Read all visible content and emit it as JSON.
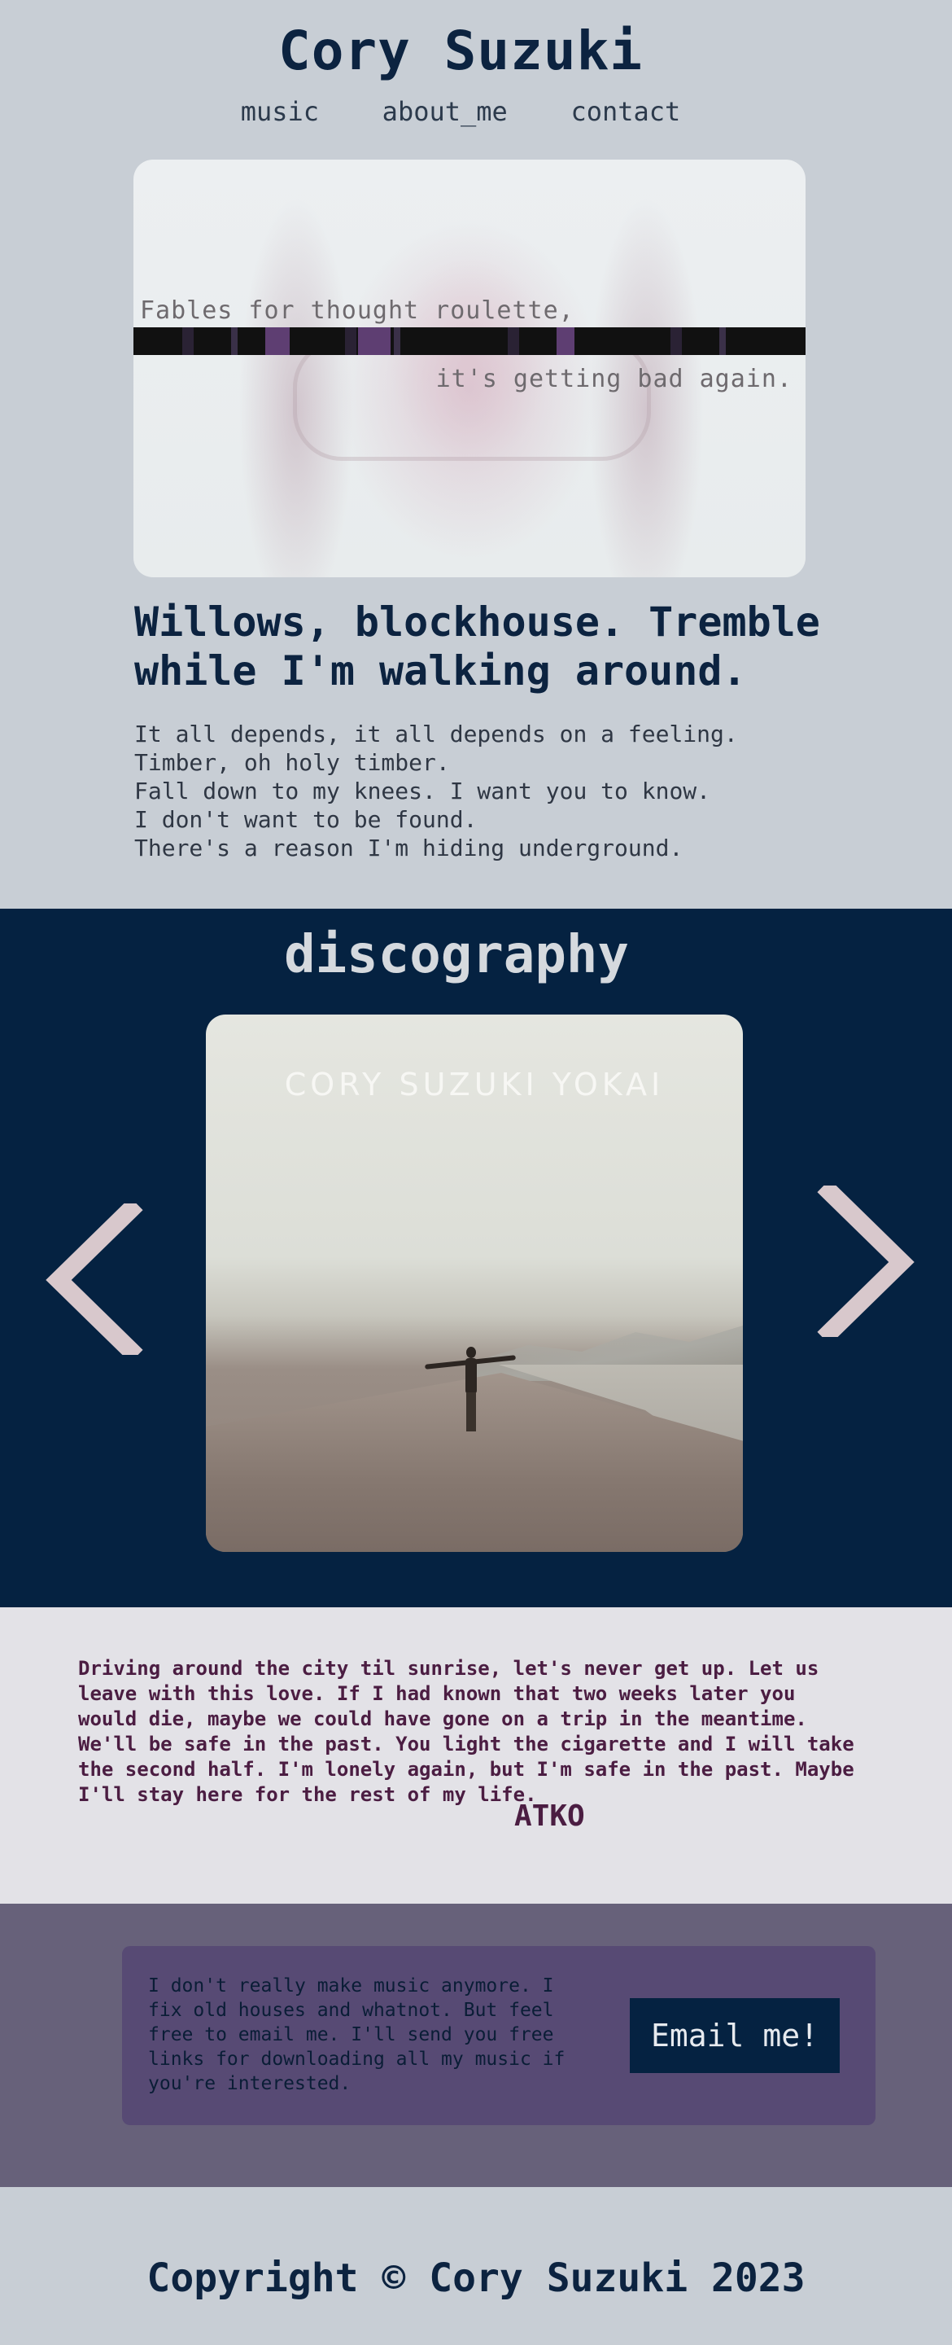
{
  "site": {
    "title": "Cory Suzuki"
  },
  "nav": {
    "items": [
      "music",
      "about_me",
      "contact"
    ]
  },
  "hero": {
    "image_line1": "Fables for thought roulette,",
    "image_line2": "it's getting bad again.",
    "heading": "Willows, blockhouse. Tremble while I'm walking around.",
    "lyrics": [
      "It all depends, it all depends on a feeling.",
      "Timber, oh holy timber.",
      "Fall down to my knees. I want you to know.",
      "I don't want to be found.",
      "There's a reason I'm hiding underground."
    ]
  },
  "discography": {
    "title": "discography",
    "album_title": "CORY SUZUKI YOKAI",
    "arrow_left_icon": "chevron-left-icon",
    "arrow_right_icon": "chevron-right-icon"
  },
  "quote": {
    "text": "Driving around the city til sunrise, let's never get up. Let us leave with this love. If I had known that two weeks later you would die, maybe we could have gone on a trip in the meantime. We'll be safe in the past. You light the cigarette and I will take the second half. I'm lonely again, but I'm safe in the past. Maybe I'll stay here for the rest of my life.",
    "author": "ATKO"
  },
  "contact": {
    "text": "I don't really make music anymore. I fix old houses and whatnot. But feel free to email me. I'll send you free links for downloading all my music if you're interested.",
    "button_label": "Email me!"
  },
  "footer": {
    "copyright": "Copyright © Cory Suzuki 2023"
  },
  "colors": {
    "navy": "#052241",
    "background": "#c8ced5",
    "quote_bg": "#e3e2e7",
    "contact_bg": "#67617a",
    "card_bg": "#574a74",
    "arrow": "#d8c8cc",
    "plum_text": "#4b1d42"
  }
}
